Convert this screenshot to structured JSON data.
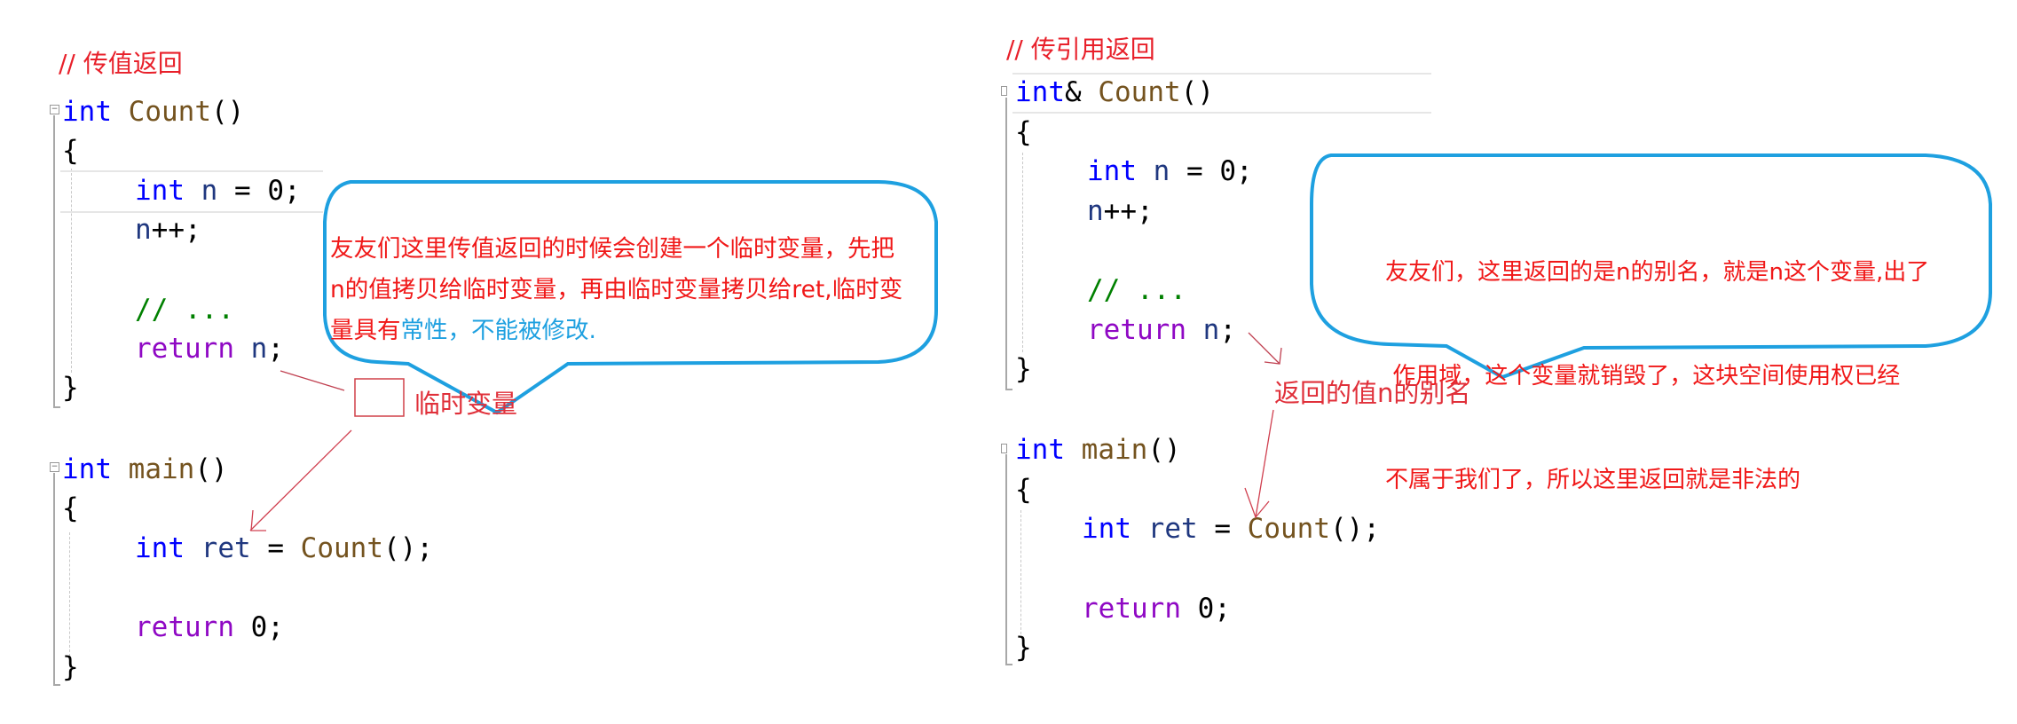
{
  "left_panel": {
    "heading": "// 传值返回",
    "count_func": {
      "signature": {
        "type": "int",
        "name": "Count",
        "parens": "()"
      },
      "open_brace": "{",
      "line1": {
        "type": "int",
        "var": "n",
        "rest": " = 0;"
      },
      "line2": {
        "var": "n",
        "rest": "++;"
      },
      "line3": {
        "comment": "// ..."
      },
      "line4": {
        "keyword": "return",
        "var": "n",
        "rest": ";"
      },
      "close_brace": "}"
    },
    "main_func": {
      "signature": {
        "type": "int",
        "name": "main",
        "parens": "()"
      },
      "open_brace": "{",
      "line1": {
        "type": "int",
        "var": "ret",
        "eq": " = ",
        "call": "Count",
        "rest": "();"
      },
      "line2": {
        "keyword": "return",
        "rest": " 0;"
      },
      "close_brace": "}"
    },
    "bubble": {
      "line1": "友友们这里传值返回的时候会创建一个临时变量，先把",
      "line2": "n的值拷贝给临时变量，再由临时变量拷贝给ret,临时变",
      "line3_red": "量具有",
      "line3_blue": "常性，不能被修改."
    },
    "temp_label": "临时变量"
  },
  "right_panel": {
    "heading": "// 传引用返回",
    "count_func": {
      "signature": {
        "type": "int",
        "amp": "&",
        "name": "Count",
        "parens": "()"
      },
      "open_brace": "{",
      "line1": {
        "type": "int",
        "var": "n",
        "rest": " = 0;"
      },
      "line2": {
        "var": "n",
        "rest": "++;"
      },
      "line3": {
        "comment": "// ..."
      },
      "line4": {
        "keyword": "return",
        "var": "n",
        "rest": ";"
      },
      "close_brace": "}"
    },
    "main_func": {
      "signature": {
        "type": "int",
        "name": "main",
        "parens": "()"
      },
      "open_brace": "{",
      "line1": {
        "type": "int",
        "var": "ret",
        "eq": " = ",
        "call": "Count",
        "rest": "();"
      },
      "line2": {
        "keyword": "return",
        "rest": " 0;"
      },
      "close_brace": "}"
    },
    "bubble": {
      "line1": "友友们，这里返回的是n的别名，就是n这个变量,出了",
      "line2": " 作用域，这个变量就销毁了，这块空间使用权已经",
      "line3": "不属于我们了，所以这里返回就是非法的"
    },
    "alias_label": "返回的值n的别名"
  },
  "colors": {
    "keyword": "#0000ff",
    "function": "#74531f",
    "variable": "#1f377f",
    "return": "#8f08c4",
    "comment": "#008000",
    "annotation_red": "#f01818",
    "bubble_border": "#1ea0e0"
  }
}
